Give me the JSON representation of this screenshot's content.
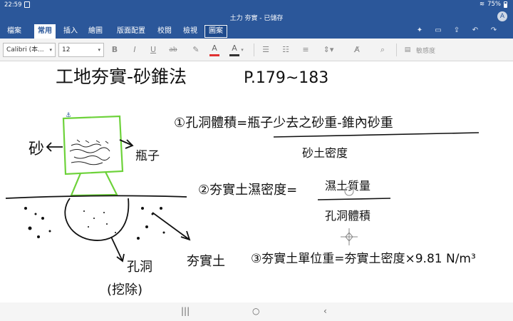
{
  "status": {
    "time": "22:59",
    "battery": "75%"
  },
  "window": {
    "title": "土力 夯實 - 已儲存",
    "avatar": "A"
  },
  "ribbon": {
    "tabs": [
      "檔案",
      "常用",
      "插入",
      "繪圖",
      "版面配置",
      "校閱",
      "檢視",
      "圖案"
    ],
    "active_index": 1
  },
  "toolbar": {
    "font_name": "Calibri (本...",
    "font_size": "12",
    "bold": "B",
    "italic": "I",
    "underline": "U",
    "strike": "ab",
    "font_color_letter": "A",
    "highlight_letter": "A",
    "sensitivity": "敏感度"
  },
  "notes": {
    "title": "工地夯實-砂錐法",
    "pages": "P.179~183",
    "label_sand": "砂",
    "label_bottle": "瓶子",
    "label_compacted_soil": "夯實土",
    "label_hole": "孔洞",
    "label_dig": "(挖除)",
    "eq1_num": "①孔洞體積=瓶子少去之砂重-錐內砂重",
    "eq1_den": "砂土密度",
    "eq2_lhs": "②夯實土濕密度=",
    "eq2_num": "濕土質量",
    "eq2_den": "孔洞體積",
    "eq3": "③夯實土單位重=夯實土密度×9.81 N/m³"
  },
  "colors": {
    "ribbon": "#2b579a",
    "ink": "#111111",
    "green_ink": "#6dd23a",
    "font_color_bar": "#e03131"
  }
}
